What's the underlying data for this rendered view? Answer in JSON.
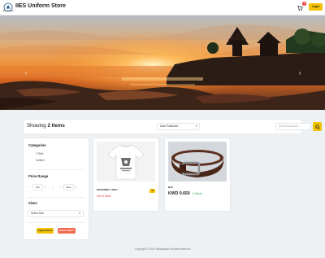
{
  "header": {
    "logo_caption": "IIES STORE",
    "title": "IIES Uniform Store",
    "cart_count": "0",
    "login_label": "Login"
  },
  "hero": {
    "prev_glyph": "‹",
    "next_glyph": "›"
  },
  "listing": {
    "showing_prefix": "Showing",
    "showing_count": "2 Items",
    "sort_selected": "Date Published",
    "search_placeholder": "Search products ..."
  },
  "filters": {
    "categories_title": "Categories",
    "categories": [
      "T-Shirt",
      "Uniform"
    ],
    "price_title": "Price Range",
    "price_min": "Min",
    "price_max": "Max",
    "sizes_title": "Sizes",
    "size_selected": "Select Size",
    "apply_label": "Apply Filters",
    "reset_label": "Reset Filters"
  },
  "products": [
    {
      "name": "MAKEONE T-Shirt",
      "stock": "Out of Stock",
      "tag": "S"
    },
    {
      "name": "Belt",
      "price": "KWD 0.650",
      "stock": "In Stock"
    }
  ],
  "footer": {
    "text": "Copyright © 2024 Halaastique All rights reserved"
  },
  "colors": {
    "accent": "#f2c200",
    "danger": "#e53935",
    "success": "#2e9e4f",
    "reset": "#f06a4f"
  }
}
